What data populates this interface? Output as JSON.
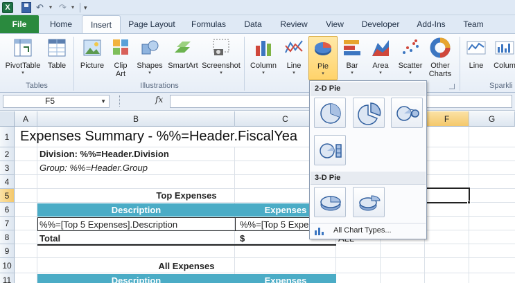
{
  "qat": {
    "app_icon": "excel-icon",
    "save_icon": "save-icon",
    "undo_icon": "undo-icon",
    "redo_icon": "redo-icon",
    "customize_icon": "customize-qat-icon"
  },
  "tabs": {
    "file": "File",
    "home": "Home",
    "insert": "Insert",
    "page_layout": "Page Layout",
    "formulas": "Formulas",
    "data": "Data",
    "review": "Review",
    "view": "View",
    "developer": "Developer",
    "add_ins": "Add-Ins",
    "team": "Team"
  },
  "ribbon": {
    "pivottable": "PivotTable",
    "table": "Table",
    "picture": "Picture",
    "clip_art_1": "Clip",
    "clip_art_2": "Art",
    "shapes": "Shapes",
    "smartart": "SmartArt",
    "screenshot": "Screenshot",
    "column": "Column",
    "line": "Line",
    "pie": "Pie",
    "bar": "Bar",
    "area": "Area",
    "scatter": "Scatter",
    "other_charts_1": "Other",
    "other_charts_2": "Charts",
    "spark_line": "Line",
    "spark_column": "Colum",
    "group_tables": "Tables",
    "group_illustrations": "Illustrations",
    "group_sparklines": "Sparkli"
  },
  "formula_bar": {
    "name_box": "F5",
    "fx": "fx",
    "formula": ""
  },
  "sheet": {
    "columns": [
      "A",
      "B",
      "C",
      "D",
      "E",
      "F",
      "G"
    ],
    "rows": [
      "1",
      "2",
      "3",
      "4",
      "5",
      "6",
      "7",
      "8",
      "9",
      "10",
      "11"
    ],
    "title": "Expenses Summary - %%=Header.FiscalYea",
    "division": "Division: %%=Header.Division",
    "group": "Group: %%=Header.Group",
    "top_expenses": "Top Expenses",
    "description_header": "Description",
    "expenses_header": "Expenses",
    "top5_desc": "%%=[Top 5 Expenses].Description",
    "top5_exp": "%%=[Top 5 Expe",
    "total": "Total",
    "dollar": "$",
    "all_label": "ALL",
    "all_expenses": "All Expenses",
    "description_header_2": "Description",
    "expenses_header_2": "Expenses"
  },
  "pie_gallery": {
    "section_2d": "2-D Pie",
    "section_3d": "3-D Pie",
    "footer": "All Chart Types...",
    "items_2d": [
      "pie-icon",
      "exploded-pie-icon",
      "pie-of-pie-icon",
      "bar-of-pie-icon"
    ],
    "items_3d": [
      "pie-3d-icon",
      "exploded-pie-3d-icon"
    ]
  },
  "colors": {
    "accent_teal": "#4bacc6",
    "file_tab": "#2a8a3e",
    "selected_button": "#ffd36b"
  }
}
